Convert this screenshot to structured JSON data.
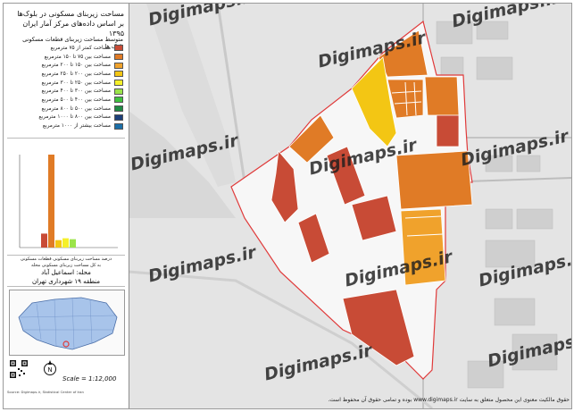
{
  "sidebar": {
    "title_line1": "مساحت زیربنای مسکونی در بلوک‌ها",
    "title_line2": "بر اساس داده‌های مرکز آمار ایران ۱۳۹۵",
    "legend_title": "متوسط مساحت زیربنای قطعات مسکونی بلوک ها",
    "chart_caption_line1": "درصد مساحت زیربنای مسکونی قطعات مسکونی",
    "chart_caption_line2": "به کل مساحت زیربنای مسکونی محله",
    "neighborhood_label": "محله: اسماعیل آباد",
    "region_label": "منطقه ۱۹ شهرداری تهران",
    "scale_text": "Scale = 1:12,000",
    "north_label": "N",
    "credit_text": "Source: Digimaps.ir, Statistical Center of Iran"
  },
  "legend_items": [
    {
      "label": "مساحت کمتر از ۷۵ مترمربع",
      "color": "#c84b36"
    },
    {
      "label": "مساحت بین ۷۵ تا ۱۵۰ مترمربع",
      "color": "#e07b26"
    },
    {
      "label": "مساحت بین ۱۵۰ تا ۲۰۰ مترمربع",
      "color": "#f0a22c"
    },
    {
      "label": "مساحت بین ۲۰۰ تا ۲۵۰ مترمربع",
      "color": "#f3c614"
    },
    {
      "label": "مساحت بین ۲۵۰ تا ۳۰۰ مترمربع",
      "color": "#f5f02a"
    },
    {
      "label": "مساحت بین ۳۰۰ تا ۴۰۰ مترمربع",
      "color": "#9be44a"
    },
    {
      "label": "مساحت بین ۴۰۰ تا ۵۰۰ مترمربع",
      "color": "#3fc23f"
    },
    {
      "label": "مساحت بین ۵۰۰ تا ۸۰۰ مترمربع",
      "color": "#1f8a44"
    },
    {
      "label": "مساحت بین ۸۰۰ تا ۱۰۰۰ مترمربع",
      "color": "#1d3f7a"
    },
    {
      "label": "مساحت بیشتر از ۱۰۰۰ مترمربع",
      "color": "#1c6fa8"
    }
  ],
  "chart_data": {
    "type": "bar",
    "values": [
      15,
      100,
      8,
      10,
      9
    ],
    "colors": [
      "#c84b36",
      "#e07b26",
      "#f3c614",
      "#f5f02a",
      "#9be44a"
    ],
    "ylim": [
      0,
      100
    ]
  },
  "map": {
    "watermark": "Digimaps.ir",
    "copyright": "حقوق مالکیت معنوی این محصول متعلق به سایت www.digimaps.ir بوده و تمامی حقوق آن محفوظ است."
  }
}
